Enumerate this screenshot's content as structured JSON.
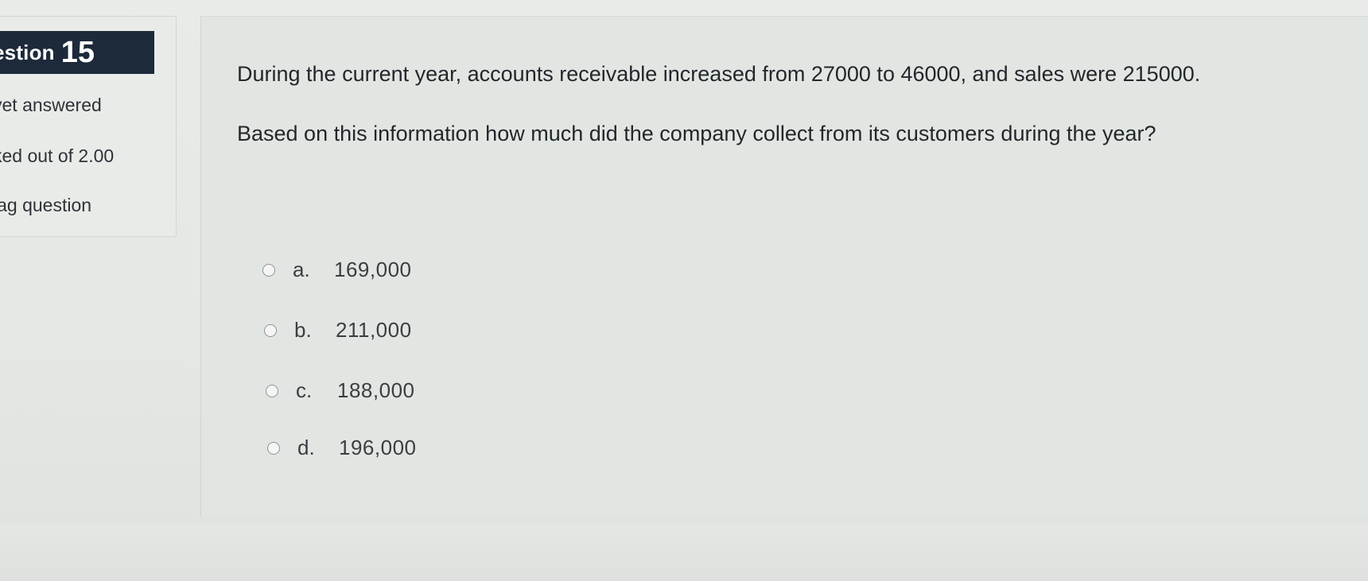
{
  "info": {
    "question_prefix": "estion",
    "question_number": "15",
    "status": "yet answered",
    "marks": "ked out of 2.00",
    "flag": "lag question"
  },
  "question": {
    "line1": "During the current year, accounts receivable increased from 27000 to 46000, and sales were 215000.",
    "line2": "Based on this information how much did the company collect from its customers during the year?"
  },
  "options": [
    {
      "letter": "a.",
      "value": "169,000"
    },
    {
      "letter": "b.",
      "value": "211,000"
    },
    {
      "letter": "c.",
      "value": "188,000"
    },
    {
      "letter": "d.",
      "value": "196,000"
    }
  ],
  "colors": {
    "question_number_bg": "#1d2a3a",
    "page_bg": "#e4e7e4"
  }
}
